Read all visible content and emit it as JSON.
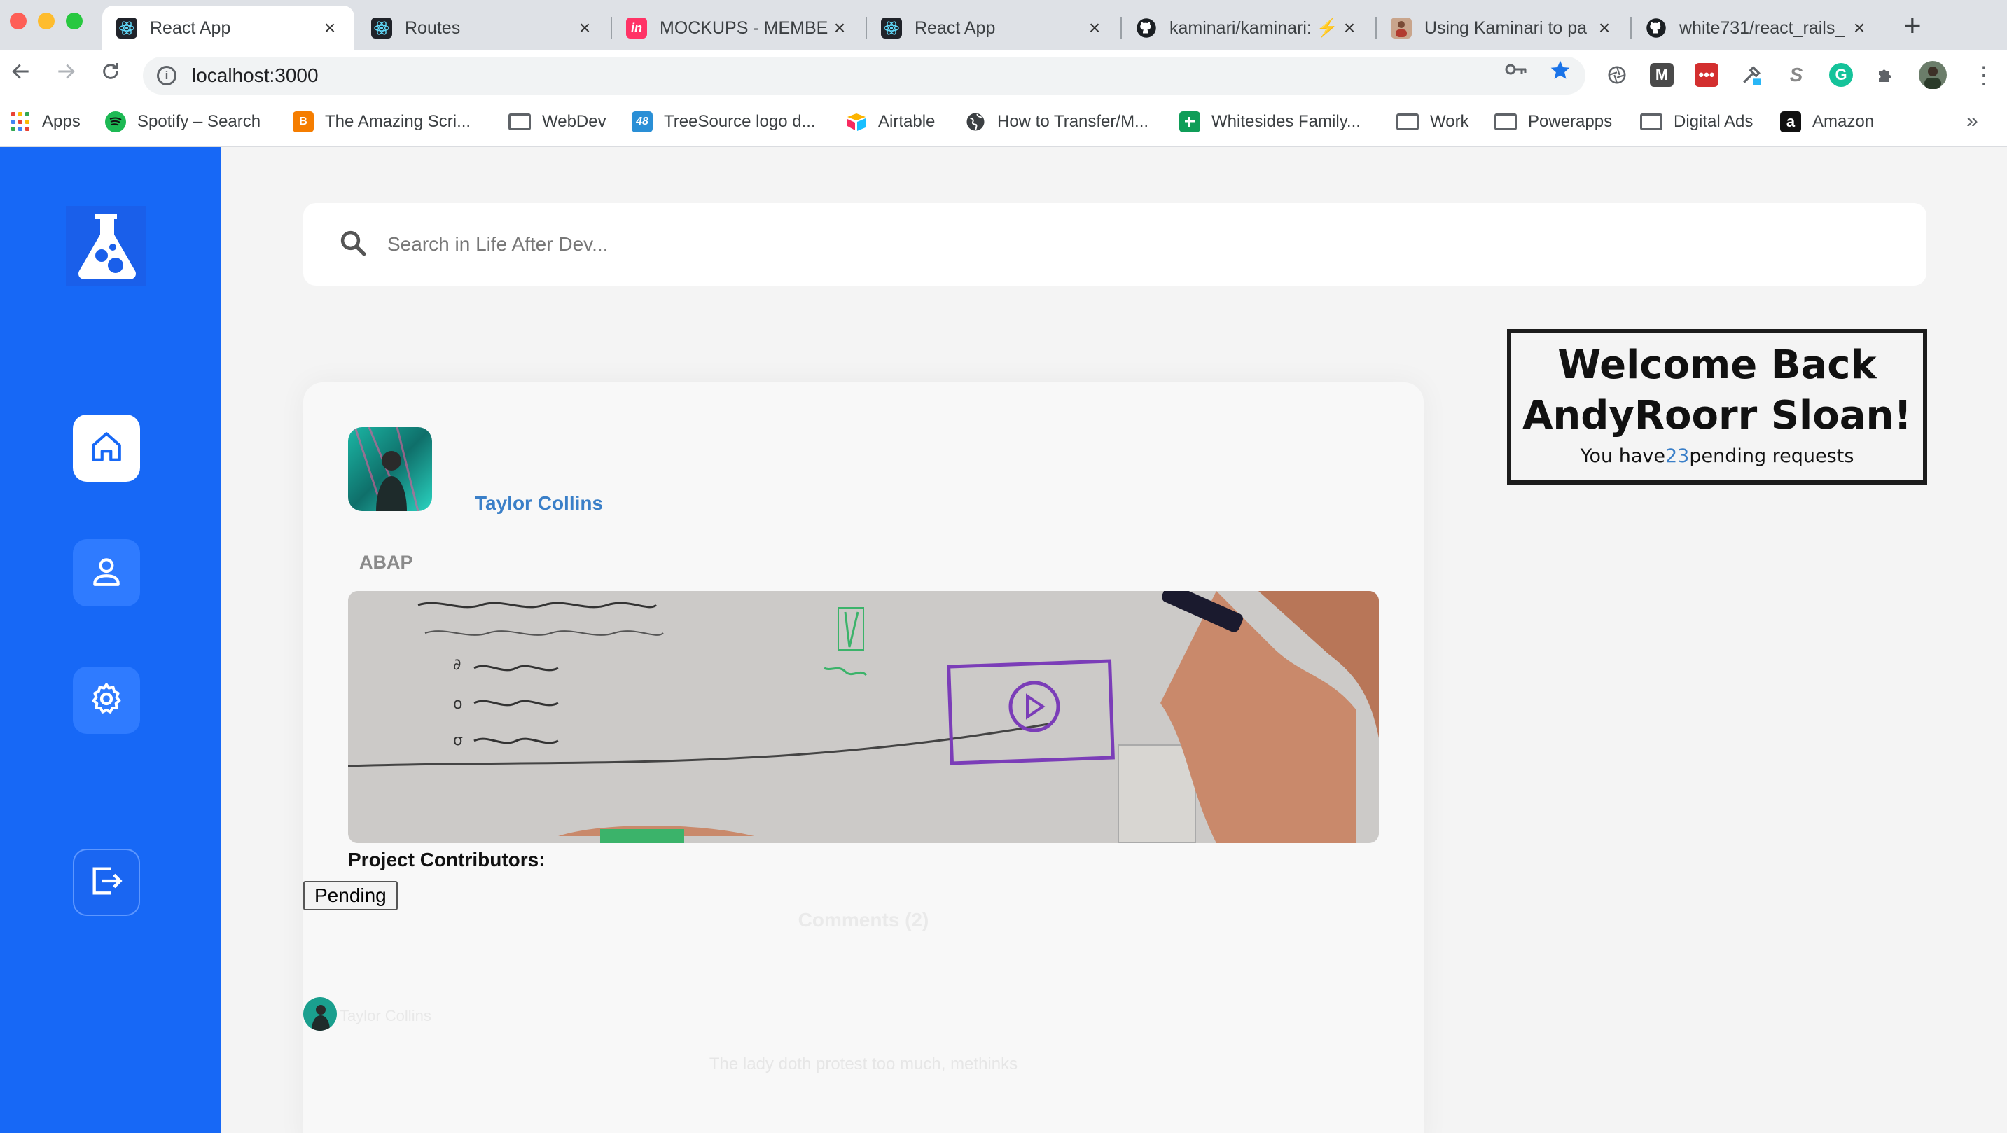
{
  "browser": {
    "tabs": [
      {
        "title": "React App",
        "icon": "react-icon",
        "active": true
      },
      {
        "title": "Routes",
        "icon": "react-icon",
        "active": false
      },
      {
        "title": "MOCKUPS - MEMBE",
        "icon": "invision-icon",
        "active": false
      },
      {
        "title": "React App",
        "icon": "react-icon",
        "active": false
      },
      {
        "title": "kaminari/kaminari: ⚡",
        "icon": "github-icon",
        "active": false
      },
      {
        "title": "Using Kaminari to pa",
        "icon": "person-icon",
        "active": false
      },
      {
        "title": "white731/react_rails_",
        "icon": "github-icon",
        "active": false
      }
    ],
    "new_tab": "+",
    "url": "localhost:3000",
    "bookmarks": [
      {
        "label": "Apps",
        "icon": "apps-grid-icon"
      },
      {
        "label": "Spotify – Search",
        "icon": "spotify-icon"
      },
      {
        "label": "The Amazing Scri...",
        "icon": "blogger-icon"
      },
      {
        "label": "WebDev",
        "icon": "folder-icon"
      },
      {
        "label": "TreeSource logo d...",
        "icon": "treesource-icon"
      },
      {
        "label": "Airtable",
        "icon": "airtable-icon"
      },
      {
        "label": "How to Transfer/M...",
        "icon": "globe-icon"
      },
      {
        "label": "Whitesides Family...",
        "icon": "sheets-icon"
      },
      {
        "label": "Work",
        "icon": "folder-icon"
      },
      {
        "label": "Powerapps",
        "icon": "folder-icon"
      },
      {
        "label": "Digital Ads",
        "icon": "folder-icon"
      },
      {
        "label": "Amazon",
        "icon": "amazon-icon"
      }
    ],
    "bookmarks_more": "»"
  },
  "sidebar": {
    "logo": "flask-logo-icon",
    "items": [
      {
        "name": "home",
        "icon": "home-icon",
        "active": true
      },
      {
        "name": "profile",
        "icon": "user-icon",
        "active": false
      },
      {
        "name": "settings",
        "icon": "gear-icon",
        "active": false
      },
      {
        "name": "logout",
        "icon": "logout-icon",
        "active": false
      }
    ]
  },
  "search": {
    "placeholder": "Search in Life After Dev..."
  },
  "post": {
    "author": "Taylor Collins",
    "category": "ABAP",
    "contributors_label": "Project Contributors:",
    "pending_label": "Pending",
    "comments_heading": "Comments (2)",
    "comments": [
      {
        "author": "Taylor Collins",
        "body": "The lady doth protest too much, methinks"
      }
    ]
  },
  "welcome": {
    "title": "Welcome Back AndyRoorr Sloan!",
    "requests_prefix": "You have",
    "requests_count": "23",
    "requests_suffix": "pending requests"
  },
  "colors": {
    "sidebar": "#1768f6",
    "accent_link": "#3a7fc8",
    "card": "#f8f8f8"
  }
}
